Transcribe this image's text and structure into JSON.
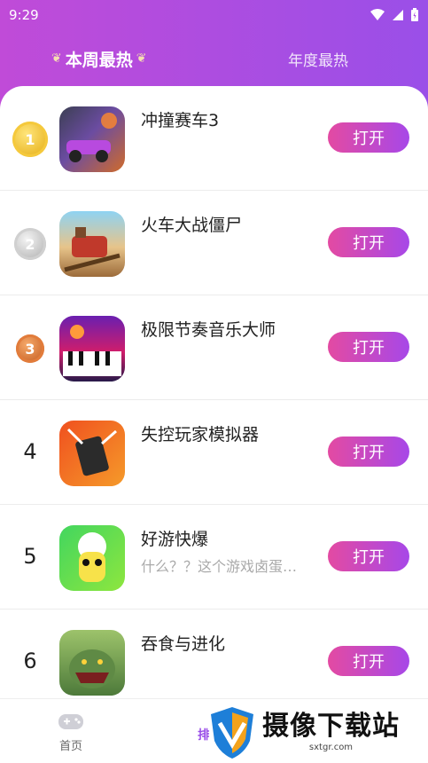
{
  "status": {
    "time": "9:29"
  },
  "tabs": {
    "weekly": "本周最热",
    "yearly": "年度最热"
  },
  "list": [
    {
      "rank": "1",
      "name": "冲撞赛车3",
      "desc": "",
      "button": "打开",
      "medal": "gold"
    },
    {
      "rank": "2",
      "name": "火车大战僵尸",
      "desc": "",
      "button": "打开",
      "medal": "silver"
    },
    {
      "rank": "3",
      "name": "极限节奏音乐大师",
      "desc": "",
      "button": "打开",
      "medal": "bronze"
    },
    {
      "rank": "4",
      "name": "失控玩家模拟器",
      "desc": "",
      "button": "打开"
    },
    {
      "rank": "5",
      "name": "好游快爆",
      "desc": "什么？？这个游戏卤蛋…",
      "button": "打开"
    },
    {
      "rank": "6",
      "name": "吞食与进化",
      "desc": "",
      "button": "打开"
    }
  ],
  "nav": {
    "home": "首页",
    "rank": "排"
  },
  "watermark": {
    "title": "摄像下载站",
    "url": "sxtgr.com"
  },
  "colors": {
    "header_start": "#c04bd8",
    "header_end": "#9a4fe8",
    "button_start": "#e34aa2",
    "button_end": "#a748e8"
  }
}
